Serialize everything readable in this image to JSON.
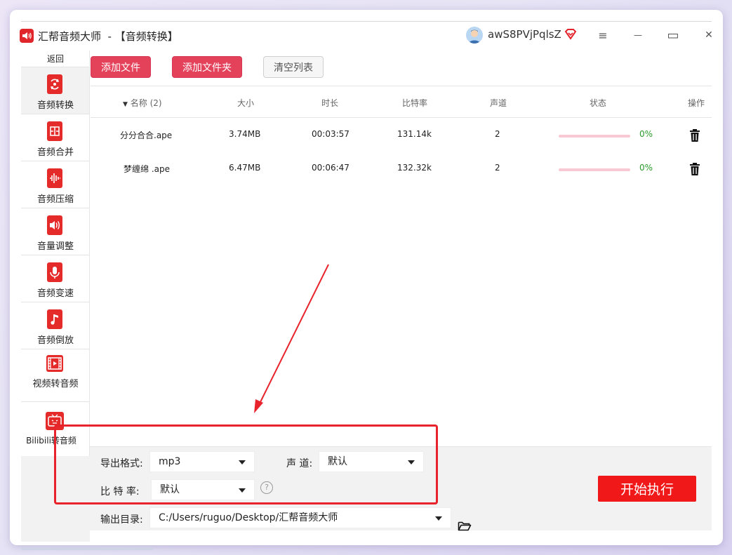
{
  "window": {
    "app_name": "汇帮音频大师",
    "title_suffix": "  - 【音频转换】",
    "username": "awS8PVjPqlsZ",
    "controls": {
      "menu": "≡",
      "minimize": "—",
      "maximize": "▭",
      "close": "✕"
    }
  },
  "sidebar": {
    "back_label": "返回",
    "items": [
      {
        "label": "音频转换",
        "icon": "audio-convert-icon",
        "active": true
      },
      {
        "label": "音频合并",
        "icon": "audio-merge-icon"
      },
      {
        "label": "音频压缩",
        "icon": "audio-compress-icon"
      },
      {
        "label": "音量调整",
        "icon": "volume-icon"
      },
      {
        "label": "音频变速",
        "icon": "microphone-icon"
      },
      {
        "label": "音频倒放",
        "icon": "music-note-icon"
      },
      {
        "label": "视频转音频",
        "icon": "video-film-icon"
      },
      {
        "label": "Bilibili转音频",
        "icon": "bilibili-tv-icon"
      }
    ]
  },
  "toolbar": {
    "add_file": "添加文件",
    "add_folder": "添加文件夹",
    "clear_list": "清空列表"
  },
  "table": {
    "columns": {
      "name": "名称 (2)",
      "size": "大小",
      "duration": "时长",
      "bitrate": "比特率",
      "channel": "声道",
      "status": "状态",
      "action": "操作"
    },
    "rows": [
      {
        "name": "分分合合.ape",
        "size": "3.74MB",
        "duration": "00:03:57",
        "bitrate": "131.14k",
        "channel": "2",
        "progress": 0,
        "percent": "0%"
      },
      {
        "name": "梦缠绵 .ape",
        "size": "6.47MB",
        "duration": "00:06:47",
        "bitrate": "132.32k",
        "channel": "2",
        "progress": 0,
        "percent": "0%"
      }
    ]
  },
  "settings": {
    "format_label": "导出格式:",
    "format_value": "mp3",
    "channel_label": "声 道:",
    "channel_value": "默认",
    "bitrate_label": "比 特 率:",
    "bitrate_value": "默认",
    "help": "?",
    "output_label": "输出目录:",
    "output_path": "C:/Users/ruguo/Desktop/汇帮音频大师",
    "start_button": "开始执行"
  },
  "colors": {
    "accent": "#e4415b",
    "start": "#f01818",
    "annotation": "#e8232b",
    "progress_track": "#f8c9d2",
    "percent": "#2a9a2a"
  }
}
